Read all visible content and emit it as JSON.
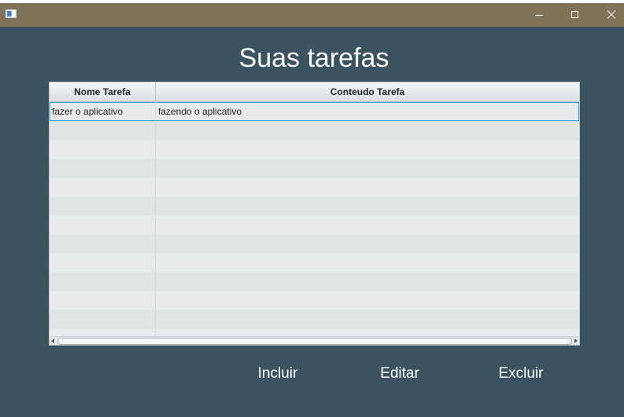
{
  "window": {
    "icon": "java-app-icon",
    "controls": [
      "minimize-icon",
      "maximize-icon",
      "close-icon"
    ]
  },
  "page": {
    "title": "Suas tarefas"
  },
  "table": {
    "columns": [
      "Nome Tarefa",
      "Conteudo Tarefa"
    ],
    "rows": [
      {
        "name": "fazer o aplicativo",
        "content": "fazendo o aplicativo"
      }
    ]
  },
  "actions": {
    "incluir": "Incluir",
    "editar": "Editar",
    "excluir": "Excluir"
  },
  "colors": {
    "background": "#3b5260",
    "titlebar": "#7f735a",
    "selection": "#3d9ed4"
  }
}
